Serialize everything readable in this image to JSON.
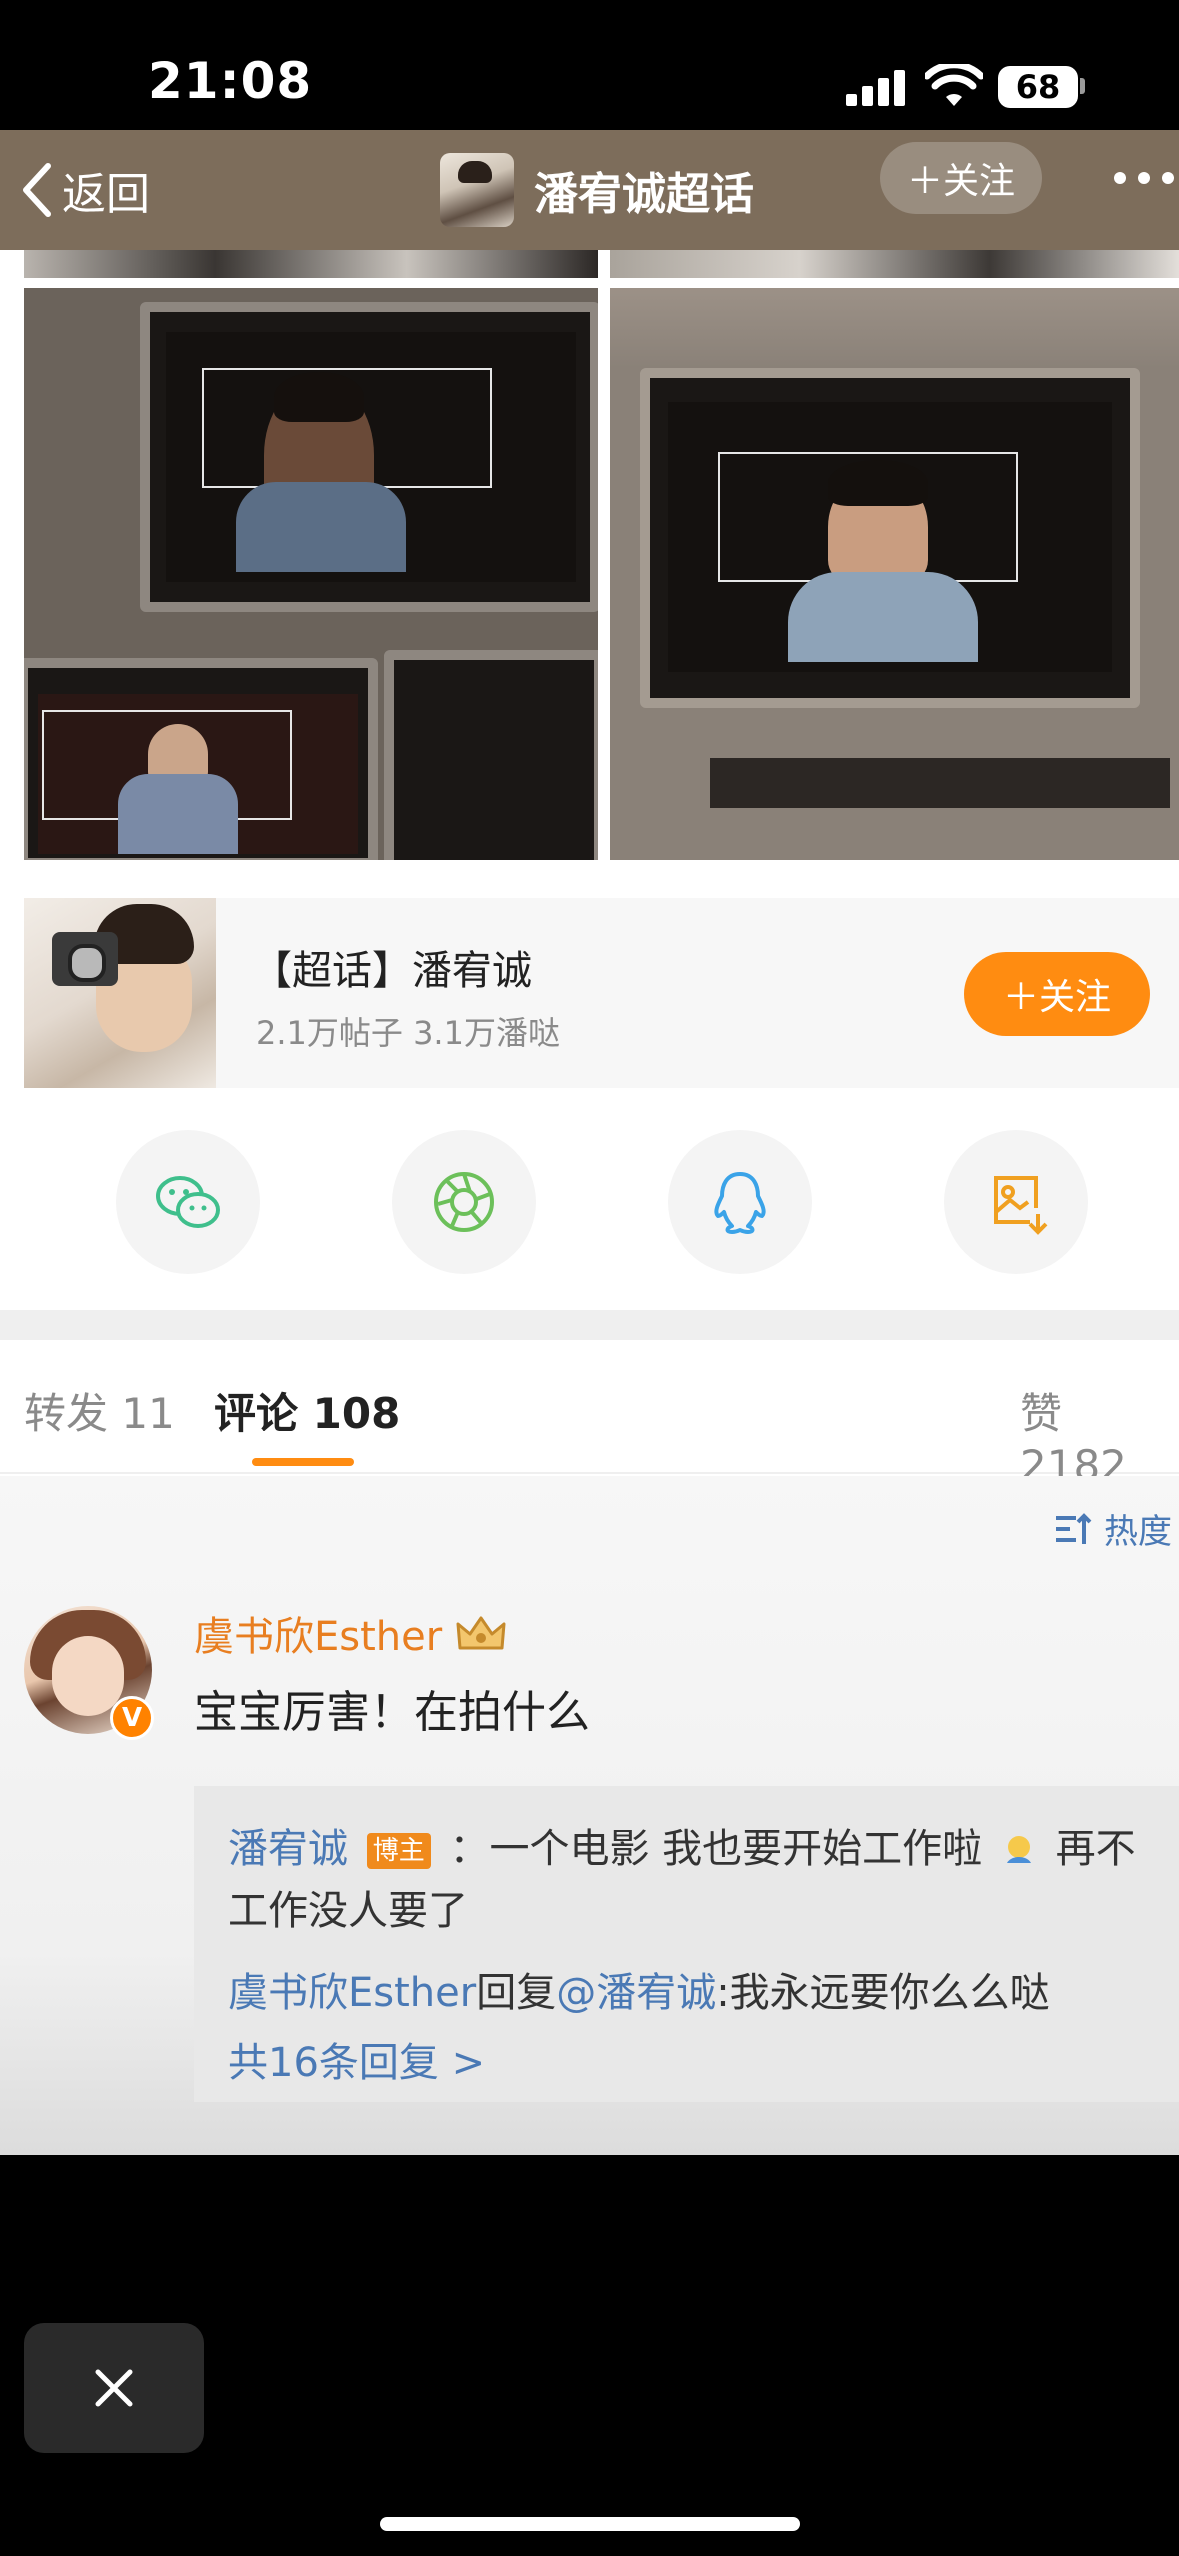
{
  "status": {
    "time": "21:08",
    "battery": "68"
  },
  "nav": {
    "back_label": "返回",
    "title": "潘宥诚超话",
    "follow_label": "＋关注"
  },
  "topic_card": {
    "title": "【超话】潘宥诚",
    "subtitle": "2.1万帖子 3.1万潘哒",
    "follow_label": "＋关注"
  },
  "share": {
    "items": [
      {
        "icon": "wechat-icon",
        "color": "#3fbf8c"
      },
      {
        "icon": "moments-icon",
        "color": "#6cc05a"
      },
      {
        "icon": "qq-icon",
        "color": "#3aa3e8"
      },
      {
        "icon": "save-image-icon",
        "color": "#f0a020"
      }
    ]
  },
  "tabs": {
    "repost": "转发 11",
    "comments": "评论 108",
    "likes": "赞 2182"
  },
  "sort": {
    "label": "热度"
  },
  "comment": {
    "author": "虞书欣Esther",
    "text": "宝宝厉害！在拍什么",
    "replies": [
      {
        "name": "潘宥诚",
        "tag": "博主",
        "text_a": "：一个电影 我也要开始工作啦",
        "text_b": "再不",
        "text_c": "工作没人要了"
      },
      {
        "name": "虞书欣Esther",
        "mid": "回复",
        "mention": "@潘宥诚",
        "text": ":我永远要你么么哒"
      }
    ],
    "more_replies": "共16条回复 >"
  },
  "colors": {
    "accent": "#ff8c11",
    "link": "#4a79b5",
    "nav_bg": "#7d6d5b"
  }
}
